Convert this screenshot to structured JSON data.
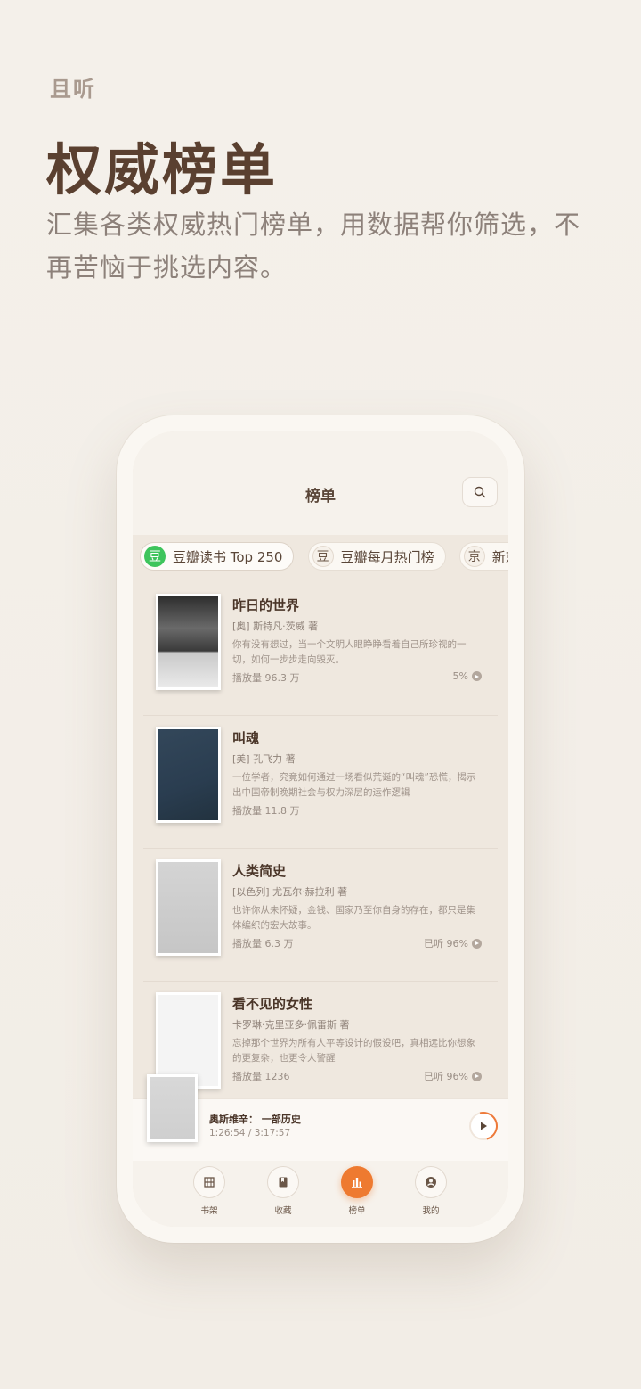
{
  "brand": "且听",
  "headline": "权威榜单",
  "subtitle": "汇集各类权威热门榜单，用数据帮你筛选，不再苦恼于挑选内容。",
  "app": {
    "title": "榜单",
    "chips": [
      {
        "icon": "豆",
        "label": "豆瓣读书 Top 250"
      },
      {
        "icon": "豆",
        "label": "豆瓣每月热门榜"
      },
      {
        "icon": "京",
        "label": "新京"
      }
    ],
    "books": [
      {
        "title": "昨日的世界",
        "author": "[奥] 斯特凡·茨威 著",
        "desc": "你有没有想过，当一个文明人眼睁睁看着自己所珍视的一切，如何一步步走向毁灭。",
        "plays": "播放量 96.3 万",
        "progress": "5%"
      },
      {
        "title": "叫魂",
        "author": "[美] 孔飞力 著",
        "desc": "一位学者，究竟如何通过一场看似荒诞的“叫魂”恐慌，揭示出中国帝制晚期社会与权力深层的运作逻辑",
        "plays": "播放量 11.8 万",
        "progress": ""
      },
      {
        "title": "人类简史",
        "author": "[以色列] 尤瓦尔·赫拉利 著",
        "desc": "也许你从未怀疑，金钱、国家乃至你自身的存在，都只是集体编织的宏大故事。",
        "plays": "播放量 6.3 万",
        "progress": "已听 96%"
      },
      {
        "title": "看不见的女性",
        "author": "卡罗琳·克里亚多·佩雷斯 著",
        "desc": "忘掉那个世界为所有人平等设计的假设吧，真相远比你想象的更复杂，也更令人警醒",
        "plays": "播放量 1236",
        "progress": "已听 96%"
      }
    ],
    "player": {
      "title": "奥斯维辛： 一部历史",
      "time": "1:26:54 / 3:17:57"
    },
    "tabs": [
      {
        "label": "书架"
      },
      {
        "label": "收藏"
      },
      {
        "label": "榜单"
      },
      {
        "label": "我的"
      }
    ]
  }
}
